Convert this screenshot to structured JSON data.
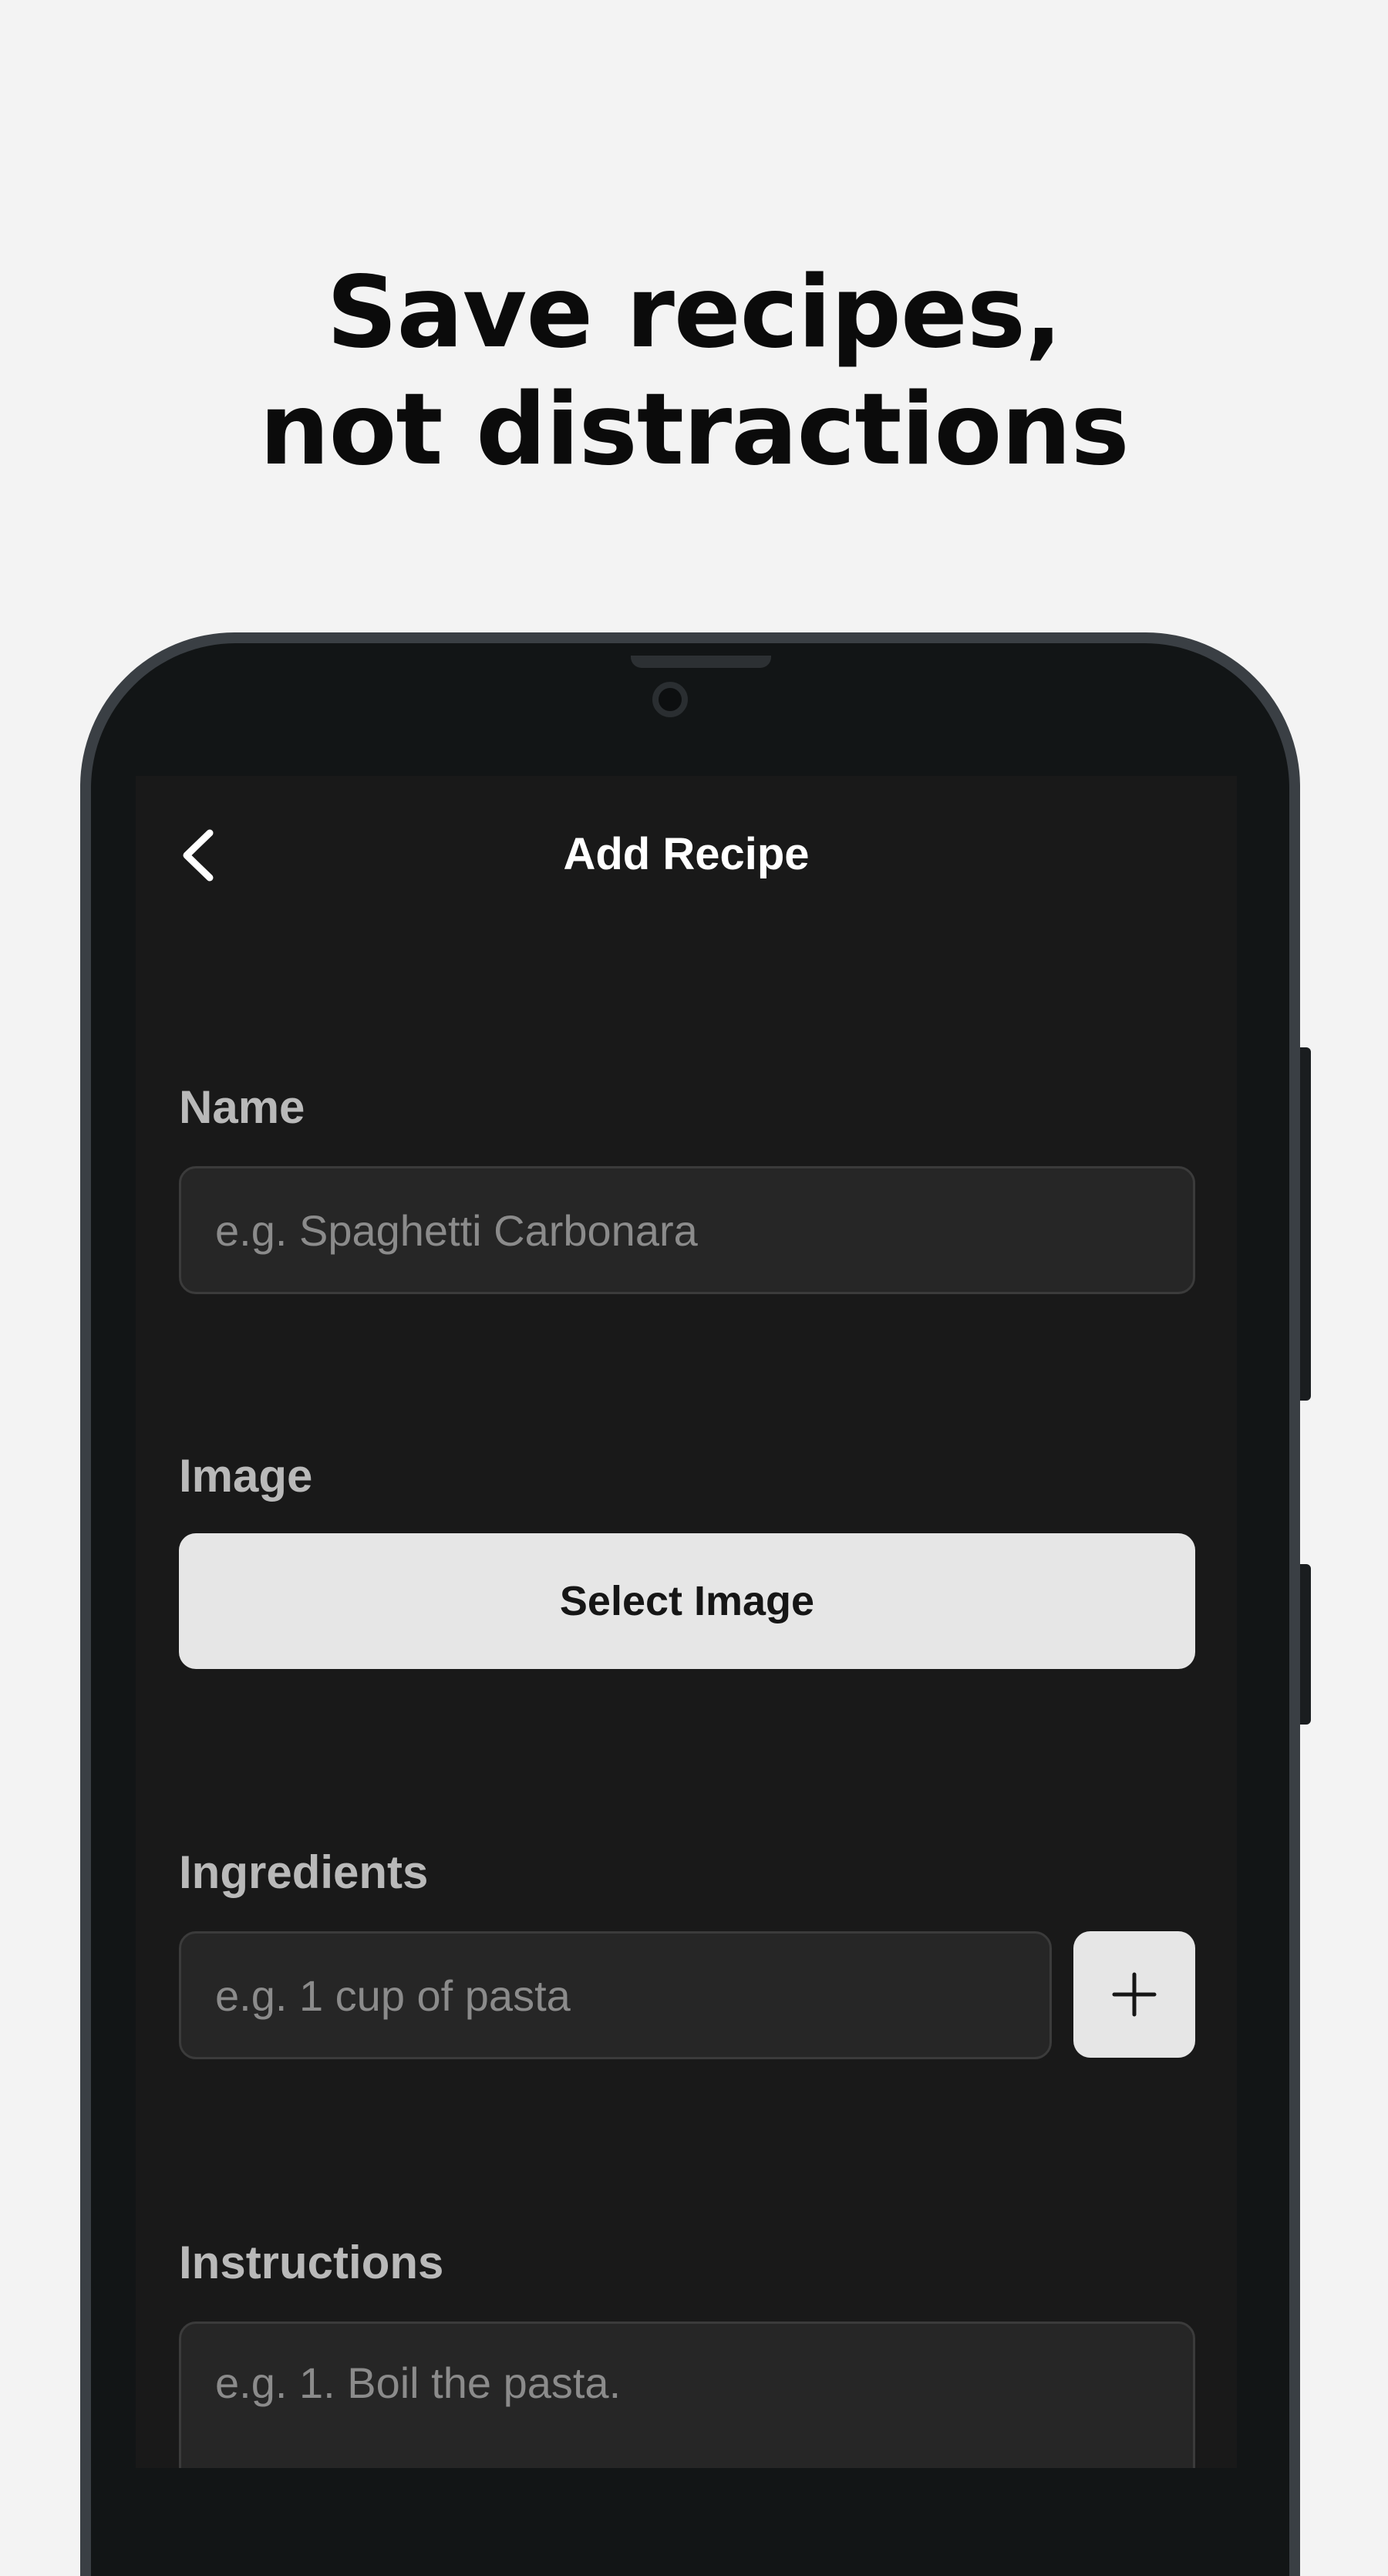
{
  "headline": {
    "line1": "Save recipes,",
    "line2": "not distractions"
  },
  "nav": {
    "back_icon": "chevron-left-icon",
    "title": "Add Recipe"
  },
  "form": {
    "name": {
      "label": "Name",
      "placeholder": "e.g. Spaghetti Carbonara"
    },
    "image": {
      "label": "Image",
      "button_label": "Select Image"
    },
    "ingredients": {
      "label": "Ingredients",
      "placeholder": "e.g. 1 cup of pasta",
      "add_icon": "plus-icon"
    },
    "instructions": {
      "label": "Instructions",
      "placeholder": "e.g. 1. Boil the pasta."
    }
  },
  "colors": {
    "background": "#f3f3f3",
    "screen": "#191919",
    "input_background": "#262626",
    "button_background": "#e6e6e6",
    "label": "#b9b9b9"
  }
}
